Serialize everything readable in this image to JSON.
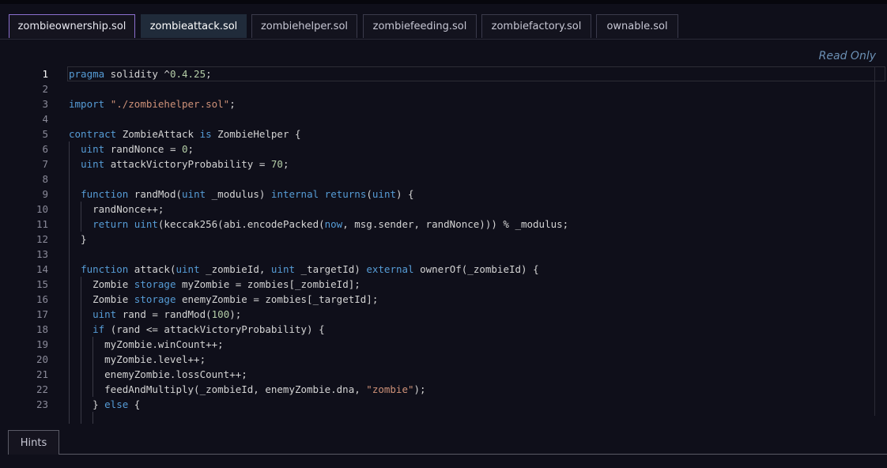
{
  "tabs": [
    {
      "label": "zombieownership.sol"
    },
    {
      "label": "zombieattack.sol"
    },
    {
      "label": "zombiehelper.sol"
    },
    {
      "label": "zombiefeeding.sol"
    },
    {
      "label": "zombiefactory.sol"
    },
    {
      "label": "ownable.sol"
    }
  ],
  "editor": {
    "status": "Read Only",
    "line_numbers": [
      "1",
      "2",
      "3",
      "4",
      "5",
      "6",
      "7",
      "8",
      "9",
      "10",
      "11",
      "12",
      "13",
      "14",
      "15",
      "16",
      "17",
      "18",
      "19",
      "20",
      "21",
      "22",
      "23"
    ],
    "lines": [
      "pragma solidity ^0.4.25;",
      "",
      "import \"./zombiehelper.sol\";",
      "",
      "contract ZombieAttack is ZombieHelper {",
      "  uint randNonce = 0;",
      "  uint attackVictoryProbability = 70;",
      "",
      "  function randMod(uint _modulus) internal returns(uint) {",
      "    randNonce++;",
      "    return uint(keccak256(abi.encodePacked(now, msg.sender, randNonce))) % _modulus;",
      "  }",
      "",
      "  function attack(uint _zombieId, uint _targetId) external ownerOf(_zombieId) {",
      "    Zombie storage myZombie = zombies[_zombieId];",
      "    Zombie storage enemyZombie = zombies[_targetId];",
      "    uint rand = randMod(100);",
      "    if (rand <= attackVictoryProbability) {",
      "      myZombie.winCount++;",
      "      myZombie.level++;",
      "      enemyZombie.lossCount++;",
      "      feedAndMultiply(_zombieId, enemyZombie.dna, \"zombie\");",
      "    } else {"
    ]
  },
  "footer": {
    "hints_label": "Hints"
  }
}
